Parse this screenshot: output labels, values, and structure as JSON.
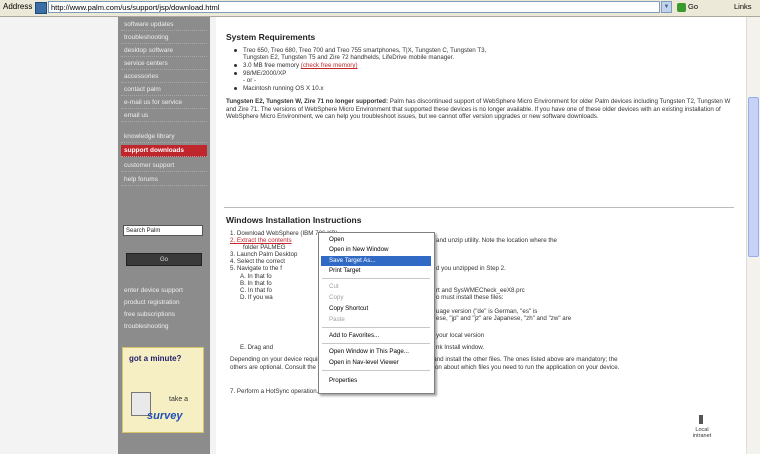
{
  "browser": {
    "address_label": "Address",
    "url": "http://www.palm.com/us/support/jsp/download.html",
    "go_label": "Go",
    "links_label": "Links"
  },
  "sidebar": {
    "items": [
      {
        "label": "software updates",
        "active": false
      },
      {
        "label": "troubleshooting",
        "active": false
      },
      {
        "label": "desktop software",
        "active": false
      },
      {
        "label": "service centers",
        "active": false
      },
      {
        "label": "accessories",
        "active": false
      },
      {
        "label": "contact palm",
        "active": false
      },
      {
        "label": "e-mail us for service",
        "active": false
      },
      {
        "label": "email us",
        "active": false
      },
      {
        "label": "knowledge library",
        "active": false
      },
      {
        "label": "support downloads",
        "active": true
      },
      {
        "label": "customer support",
        "active": false
      },
      {
        "label": "help forums",
        "active": false
      }
    ],
    "search_placeholder": "Search Palm",
    "search_button": "Go",
    "bottom_links": [
      "enter device support",
      "product registration",
      "free subscriptions",
      "troubleshooting"
    ],
    "survey": {
      "question": "got a minute?",
      "take": "take a",
      "word": "survey"
    }
  },
  "content": {
    "sysreq_heading": "System Requirements",
    "sysreq_items": [
      "Treo 650, Treo 680, Treo 700 and Treo 755 smartphones, T|X, Tungsten C, Tungsten T3,",
      "3.0 MB free memory",
      "98/ME/2000/XP",
      "Macintosh running OS X 10.x"
    ],
    "sysreq_line1b": "Tungsten E2, Tungsten T5 and Zire 72 handhelds, LifeDrive mobile manager.",
    "sysreq_link": "(check free memory)",
    "sysreq_or": "- or -",
    "note_bold": "Tungsten E2, Tungsten W, Zire 71 no longer supported:",
    "note_text": " Palm has discontinued support of WebSphere Micro Environment for older Palm devices including Tungsten T2, Tungsten W and Zire 71. The versions of WebSphere Micro Environment that supported these devices is no longer available. If you have one of these older devices with an existing installation of WebSphere Micro Environment, we can help you troubleshoot issues, but we cannot offer version upgrades or new software downloads.",
    "win_heading": "Windows Installation Instructions",
    "steps": [
      "1.  Download WebSphere (IBM 726 KB)",
      "2.  Extract the contents",
      "3.  Launch Palm Desktop",
      "4.  Select the correct",
      "5.  Navigate to the f",
      "A.  In that fo",
      "B.  In that fo",
      "C.  In that fo",
      "D.  If you wa",
      "E.  Drag and",
      "6.  Depending on"
    ],
    "step2_tail": "and unzip utility. Note the location where the",
    "step2_tail2": "folder PALMEG",
    "step5_tail": "d you unzipped in Step 2.",
    "stepC_tail": "rt and SysWMECheck_eeX8.prc",
    "stepD_tail": "o must install these files:",
    "lang_tail": "uage version (\"de\" is German, \"es\" is",
    "lang_tail2": "ese, \"jp\" and \"jz\" are Japanese, \"zh\" and \"zw\" are",
    "local_tail": "your local version",
    "drag_tail": "nk Install window.",
    "step6_text": "Depending on your device requirements you can explore the other folders and install the other files. The ones listed above are mandatory; the others are optional. Consult the Java software developer for more information about which files you need to run the application on your device.",
    "step7": "7.  Perform a HotSync operation."
  },
  "context_menu": {
    "items": [
      {
        "label": "Open",
        "disabled": false,
        "highlighted": false
      },
      {
        "label": "Open in New Window",
        "disabled": false,
        "highlighted": false
      },
      {
        "label": "Save Target As...",
        "disabled": false,
        "highlighted": true
      },
      {
        "label": "Print Target",
        "disabled": false,
        "highlighted": false
      },
      {
        "label": "Cut",
        "disabled": true,
        "highlighted": false
      },
      {
        "label": "Copy",
        "disabled": true,
        "highlighted": false
      },
      {
        "label": "Copy Shortcut",
        "disabled": false,
        "highlighted": false
      },
      {
        "label": "Paste",
        "disabled": true,
        "highlighted": false
      },
      {
        "label": "Add to Favorites...",
        "disabled": false,
        "highlighted": false
      },
      {
        "label": "Open Window in This Page...",
        "disabled": false,
        "highlighted": false
      },
      {
        "label": "Open in Nav-level Viewer",
        "disabled": false,
        "highlighted": false
      },
      {
        "label": "Properties",
        "disabled": false,
        "highlighted": false
      }
    ]
  },
  "status": {
    "label": "Local intranet"
  }
}
